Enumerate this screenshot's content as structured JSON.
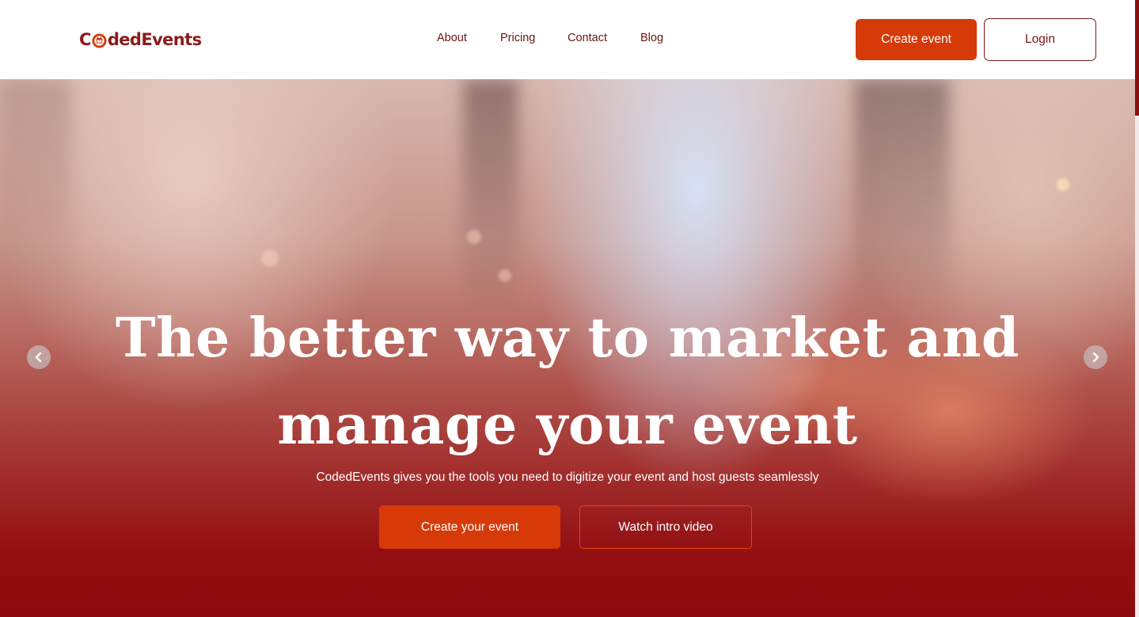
{
  "brand": {
    "logo_prefix": "C",
    "logo_suffix": "dedEvents",
    "logo_mark_icon": "calendar-o-icon",
    "primary_color": "#d63a09",
    "dark_color": "#7a1616"
  },
  "nav": {
    "links": [
      {
        "label": "About"
      },
      {
        "label": "Pricing"
      },
      {
        "label": "Contact"
      },
      {
        "label": "Blog"
      }
    ],
    "create_event_label": "Create event",
    "login_label": "Login"
  },
  "hero": {
    "title_line1": "The better way to market and",
    "title_line2": "manage your event",
    "subtitle": "CodedEvents gives you the tools you need to digitize your event and host guests seamlessly",
    "primary_cta": "Create your event",
    "secondary_cta": "Watch intro video",
    "prev_icon": "chevron-left-icon",
    "next_icon": "chevron-right-icon"
  }
}
